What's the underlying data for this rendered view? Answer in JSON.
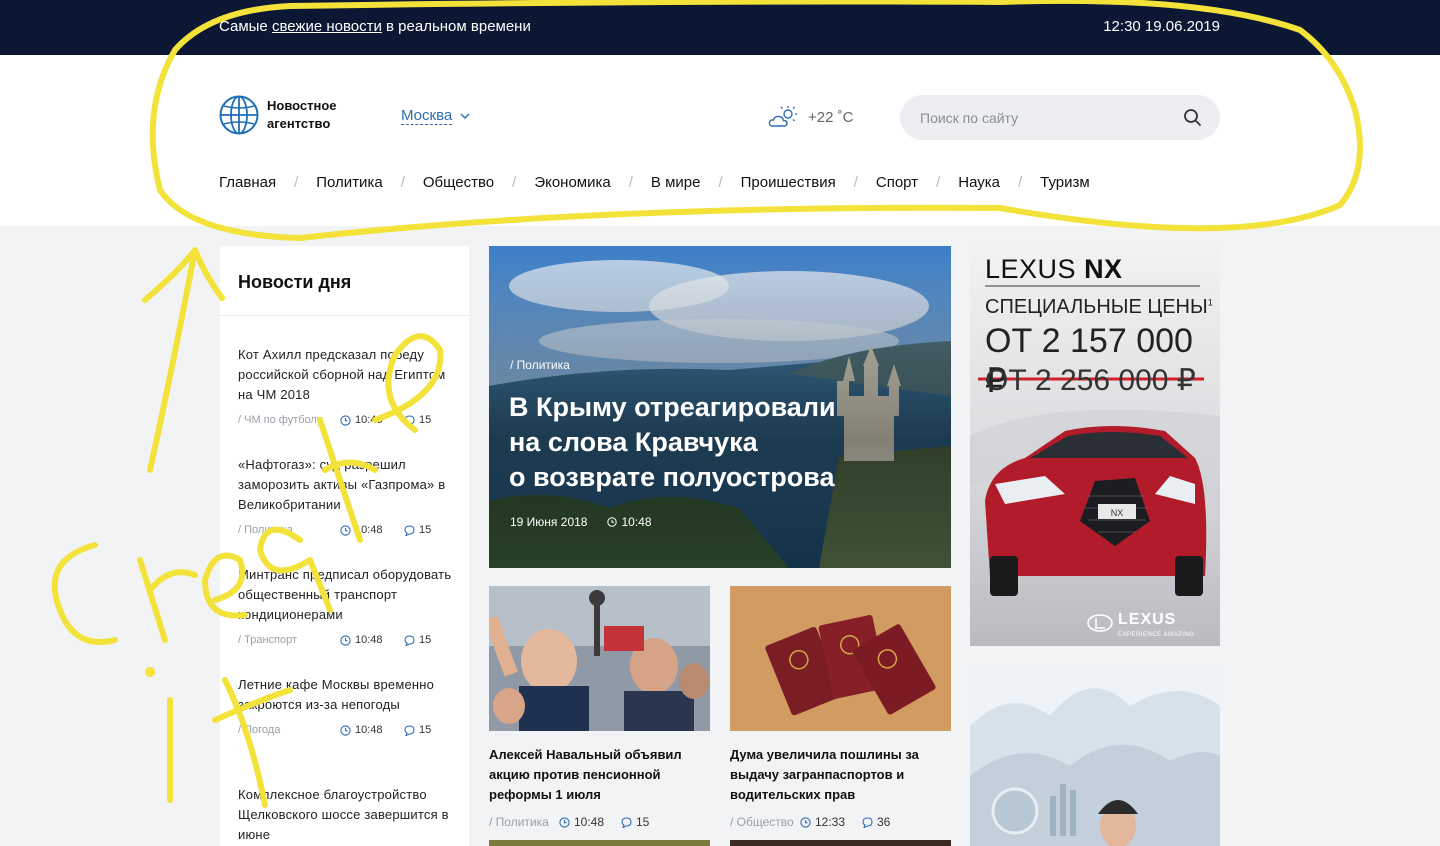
{
  "topbar": {
    "tagline_before": "Самые ",
    "tagline_link": "свежие новости",
    "tagline_after": " в реальном времени",
    "datetime": "12:30 19.06.2019"
  },
  "header": {
    "logo_line1": "Новостное",
    "logo_line2": "агентство",
    "city": "Москва",
    "weather": "+22 ˚C",
    "search_placeholder": "Поиск по сайту"
  },
  "nav": [
    "Главная",
    "Политика",
    "Общество",
    "Экономика",
    "В мире",
    "Проишествия",
    "Спорт",
    "Наука",
    "Туризм"
  ],
  "news_of_day": {
    "title": "Новости дня",
    "items": [
      {
        "text": "Кот Ахилл предсказал победу российской сборной над Египтом на ЧМ 2018",
        "category": "/ ЧМ по футболу",
        "time": "10:48",
        "comments": "15"
      },
      {
        "text": "«Нафтогаз»: суд разрешил заморозить активы «Газпрома» в Великобритании",
        "category": "/ Политика",
        "time": "10:48",
        "comments": "15"
      },
      {
        "text": "Минтранс предписал оборудовать общественный транспорт кондиционерами",
        "category": "/ Транспорт",
        "time": "10:48",
        "comments": "15"
      },
      {
        "text": "Летние кафе Москвы временно закроются из-за непогоды",
        "category": "/ Погода",
        "time": "10:48",
        "comments": "15"
      },
      {
        "text": "Комплексное благоустройство Щелковского шоссе завершится в июне",
        "category": "",
        "time": "",
        "comments": ""
      }
    ]
  },
  "hero": {
    "category": "/ Политика",
    "title_line1": "В Крыму отреагировали",
    "title_line2": "на слова Кравчука",
    "title_line3": "о возврате полуострова",
    "date": "19 Июня 2018",
    "time": "10:48"
  },
  "cards": [
    {
      "title": "Алексей Навальный объявил акцию против пенсионной реформы 1 июля",
      "category": "/ Политика",
      "time": "10:48",
      "comments": "15"
    },
    {
      "title": "Дума увеличила пошлины за выдачу загранпаспортов и водительских прав",
      "category": "/ Общество",
      "time": "12:33",
      "comments": "36"
    }
  ],
  "ad": {
    "brand": "LEXUS",
    "model": "NX",
    "special": "СПЕЦИАЛЬНЫЕ ЦЕНЫ",
    "footnote": "1",
    "price_new": "ОТ 2 157 000 ₽",
    "price_old": "ОТ 2 256 000 ₽",
    "plate": "NX",
    "logo_text": "LEXUS",
    "logo_sub": "EXPERIENCE AMAZING"
  },
  "annotation": {
    "handwritten_text": "Create it",
    "color": "#f3e23a"
  },
  "colors": {
    "topbar_bg": "#0c1833",
    "accent": "#2f6db5",
    "page_bg": "#f2f3f5"
  }
}
